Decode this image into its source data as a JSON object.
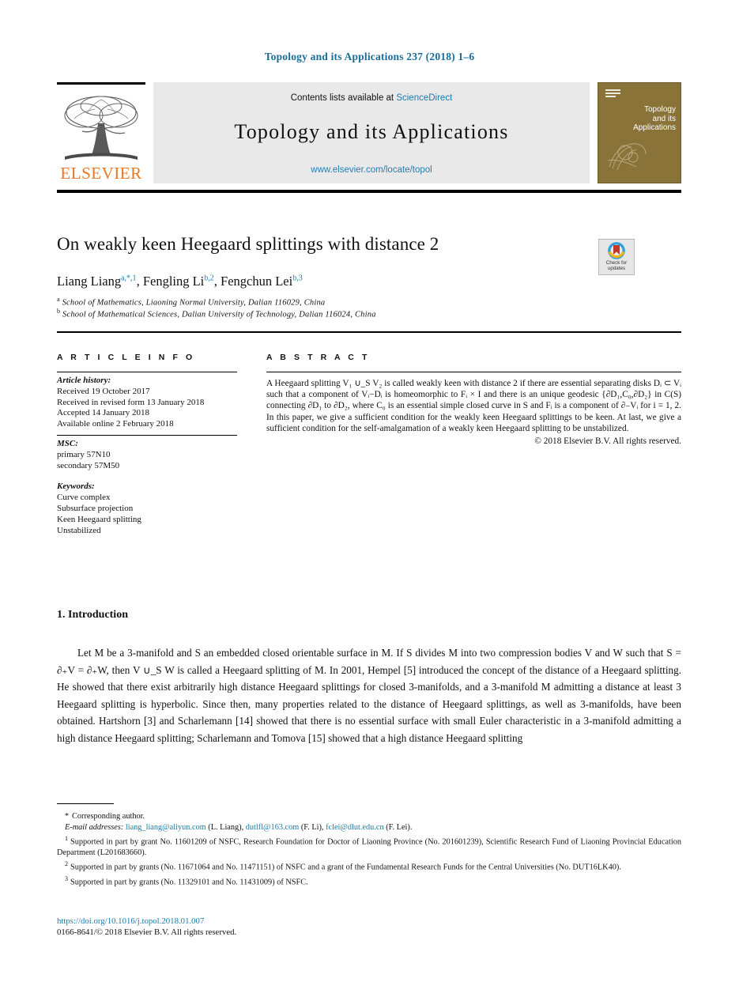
{
  "running_head": "Topology and its Applications 237 (2018) 1–6",
  "masthead": {
    "publisher_wordmark": "ELSEVIER",
    "contents_prefix": "Contents lists available at",
    "contents_link": "ScienceDirect",
    "journal_title": "Topology  and  its  Applications",
    "journal_url": "www.elsevier.com/locate/topol",
    "cover_title_line1": "Topology",
    "cover_title_line2": "and its",
    "cover_title_line3": "Applications"
  },
  "title": "On weakly keen Heegaard splittings with distance 2",
  "crossmark": {
    "line1": "Check for",
    "line2": "updates"
  },
  "authors": {
    "a1_name": "Liang Liang",
    "a1_sup": "a,*,1",
    "a2_name": "Fengling Li",
    "a2_sup": "b,2",
    "a3_name": "Fengchun Lei",
    "a3_sup": "b,3"
  },
  "affiliations": [
    {
      "marker": "a",
      "text": "School of Mathematics, Liaoning Normal University, Dalian 116029, China"
    },
    {
      "marker": "b",
      "text": "School of Mathematical Sciences, Dalian University of Technology, Dalian 116024, China"
    }
  ],
  "labels": {
    "article_info": "A R T I C L E   I N F O",
    "abstract": "A B S T R A C T"
  },
  "article_info": {
    "history_head": "Article history:",
    "history": [
      "Received 19 October 2017",
      "Received in revised form 13 January 2018",
      "Accepted 14 January 2018",
      "Available online 2 February 2018"
    ],
    "msc_head": "MSC:",
    "msc": [
      "primary 57N10",
      "secondary 57M50"
    ],
    "keywords_head": "Keywords:",
    "keywords": [
      "Curve complex",
      "Subsurface projection",
      "Keen Heegaard splitting",
      "Unstabilized"
    ]
  },
  "abstract": {
    "text": "A Heegaard splitting V₁ ∪_S V₂ is called weakly keen with distance 2 if there are essential separating disks Dᵢ ⊂ Vᵢ such that a component of Vᵢ−Dᵢ is homeomorphic to Fᵢ × I and there is an unique geodesic {∂D₁,C₀,∂D₂} in C(S) connecting ∂D₁ to ∂D₂, where C₀ is an essential simple closed curve in S and Fᵢ is a component of ∂₋Vᵢ for i = 1, 2. In this paper, we give a sufficient condition for the weakly keen Heegaard splittings to be keen. At last, we give a sufficient condition for the self-amalgamation of a weakly keen Heegaard splitting to be unstabilized.",
    "copyright": "© 2018 Elsevier B.V. All rights reserved."
  },
  "section": {
    "heading": "1. Introduction",
    "paragraph": "Let M be a 3-manifold and S an embedded closed orientable surface in M. If S divides M into two compression bodies V and W such that S = ∂₊V = ∂₊W, then V ∪_S W is called a Heegaard splitting of M. In 2001, Hempel [5] introduced the concept of the distance of a Heegaard splitting. He showed that there exist arbitrarily high distance Heegaard splittings for closed 3-manifolds, and a 3-manifold M admitting a distance at least 3 Heegaard splitting is hyperbolic. Since then, many properties related to the distance of Heegaard splittings, as well as 3-manifolds, have been obtained. Hartshorn [3] and Scharlemann [14] showed that there is no essential surface with small Euler characteristic in a 3-manifold admitting a high distance Heegaard splitting; Scharlemann and Tomova [15] showed that a high distance Heegaard splitting"
  },
  "footnotes": {
    "corresponding": "Corresponding author.",
    "email_head": "E-mail addresses:",
    "email1": "liang_liang@aliyun.com",
    "email1_owner": "(L. Liang),",
    "email2": "dutlfl@163.com",
    "email2_owner": "(F. Li),",
    "email3": "fclei@dlut.edu.cn",
    "email3_owner": "(F. Lei).",
    "note1": "Supported in part by grant No. 11601209 of NSFC, Research Foundation for Doctor of Liaoning Province (No. 201601239), Scientific Research Fund of Liaoning Provincial Education Department (L201683660).",
    "note2": "Supported in part by grants (No. 11671064 and No. 11471151) of NSFC and a grant of the Fundamental Research Funds for the Central Universities (No. DUT16LK40).",
    "note3": "Supported in part by grants (No. 11329101 and No. 11431009) of NSFC."
  },
  "footer": {
    "doi": "https://doi.org/10.1016/j.topol.2018.01.007",
    "issn_line": "0166-8641/© 2018 Elsevier B.V. All rights reserved."
  }
}
